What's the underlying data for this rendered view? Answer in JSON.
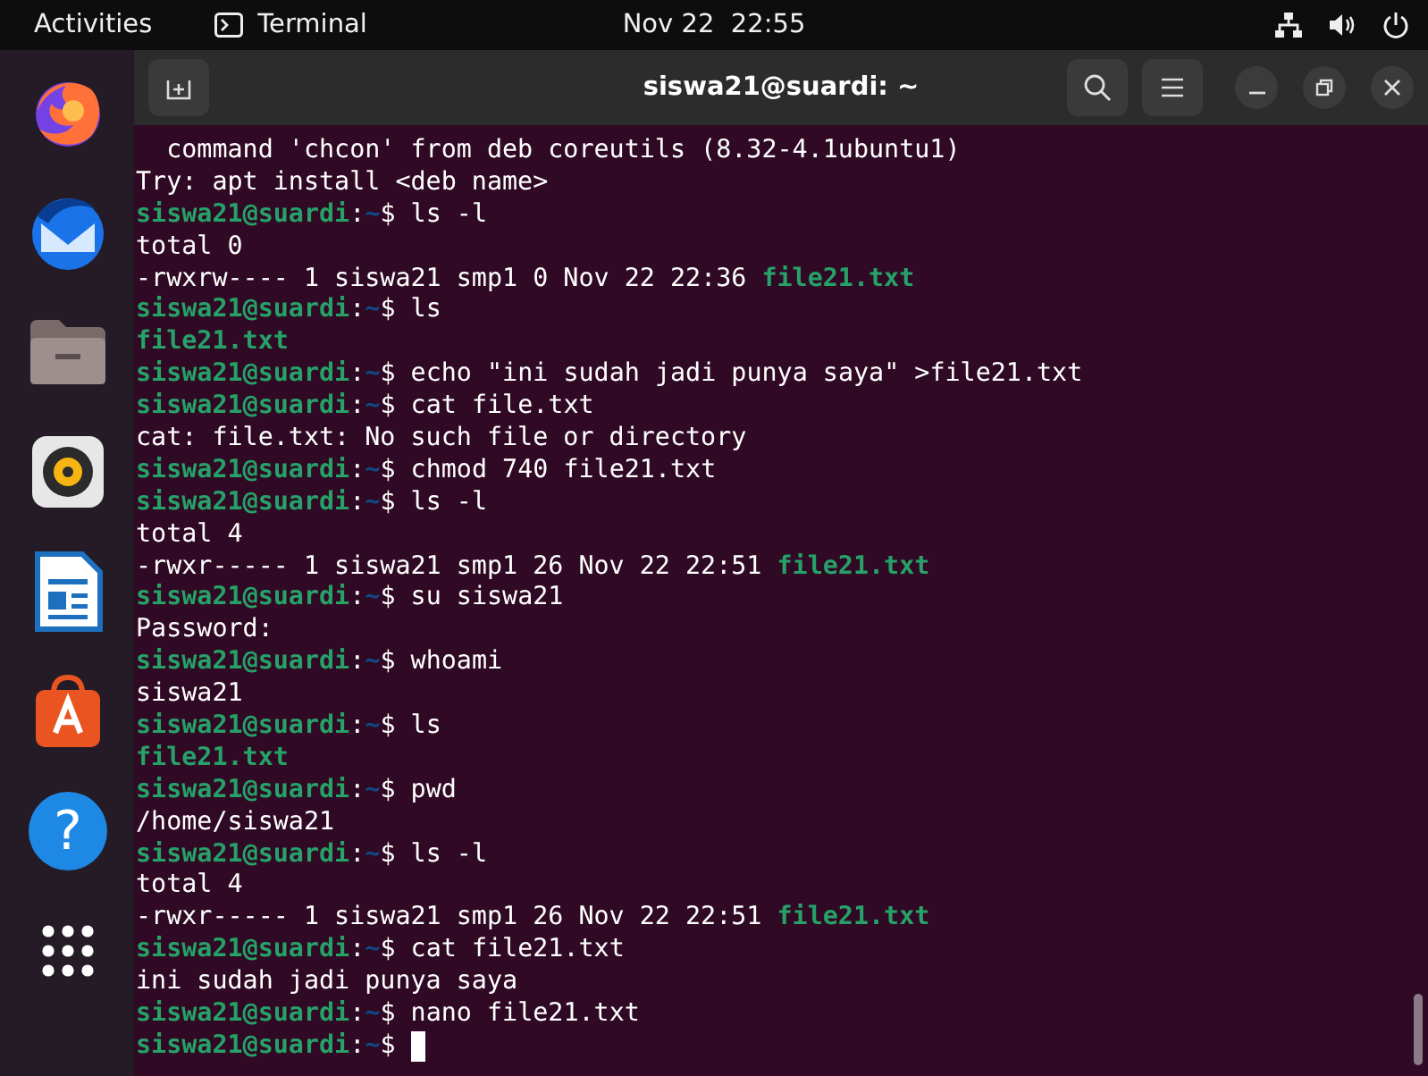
{
  "top_bar": {
    "activities": "Activities",
    "app_name": "Terminal",
    "clock": "Nov 22  22:55"
  },
  "dock": {
    "items": [
      {
        "kind": "firefox"
      },
      {
        "kind": "mail"
      },
      {
        "kind": "files"
      },
      {
        "kind": "music"
      },
      {
        "kind": "writer"
      },
      {
        "kind": "store"
      },
      {
        "kind": "help",
        "glyph": "?"
      },
      {
        "kind": "grid"
      }
    ]
  },
  "window": {
    "title": "siswa21@suardi: ~"
  },
  "terminal": {
    "cursor": true,
    "lines": [
      {
        "kind": "output",
        "text": "  command 'chcon' from deb coreutils (8.32-4.1ubuntu1)"
      },
      {
        "kind": "output",
        "text": "Try: apt install <deb name>"
      },
      {
        "kind": "prompt",
        "user": "siswa21@suardi",
        "sep": ":",
        "path": "~",
        "sign": "$",
        "command": "ls -l"
      },
      {
        "kind": "output",
        "text": "total 0"
      },
      {
        "kind": "listing",
        "text": "-rwxrw---- 1 siswa21 smp1 0 Nov 22 22:36",
        "file": "file21.txt"
      },
      {
        "kind": "prompt",
        "user": "siswa21@suardi",
        "sep": ":",
        "path": "~",
        "sign": "$",
        "command": "ls"
      },
      {
        "kind": "file",
        "file": "file21.txt"
      },
      {
        "kind": "prompt",
        "user": "siswa21@suardi",
        "sep": ":",
        "path": "~",
        "sign": "$",
        "command": "echo \"ini sudah jadi punya saya\" >file21.txt"
      },
      {
        "kind": "prompt",
        "user": "siswa21@suardi",
        "sep": ":",
        "path": "~",
        "sign": "$",
        "command": "cat file.txt"
      },
      {
        "kind": "output",
        "text": "cat: file.txt: No such file or directory"
      },
      {
        "kind": "prompt",
        "user": "siswa21@suardi",
        "sep": ":",
        "path": "~",
        "sign": "$",
        "command": "chmod 740 file21.txt"
      },
      {
        "kind": "prompt",
        "user": "siswa21@suardi",
        "sep": ":",
        "path": "~",
        "sign": "$",
        "command": "ls -l"
      },
      {
        "kind": "output",
        "text": "total 4"
      },
      {
        "kind": "listing",
        "text": "-rwxr----- 1 siswa21 smp1 26 Nov 22 22:51",
        "file": "file21.txt"
      },
      {
        "kind": "prompt",
        "user": "siswa21@suardi",
        "sep": ":",
        "path": "~",
        "sign": "$",
        "command": "su siswa21"
      },
      {
        "kind": "output",
        "text": "Password:"
      },
      {
        "kind": "prompt",
        "user": "siswa21@suardi",
        "sep": ":",
        "path": "~",
        "sign": "$",
        "command": "whoami"
      },
      {
        "kind": "output",
        "text": "siswa21"
      },
      {
        "kind": "prompt",
        "user": "siswa21@suardi",
        "sep": ":",
        "path": "~",
        "sign": "$",
        "command": "ls"
      },
      {
        "kind": "file",
        "file": "file21.txt"
      },
      {
        "kind": "prompt",
        "user": "siswa21@suardi",
        "sep": ":",
        "path": "~",
        "sign": "$",
        "command": "pwd"
      },
      {
        "kind": "output",
        "text": "/home/siswa21"
      },
      {
        "kind": "prompt",
        "user": "siswa21@suardi",
        "sep": ":",
        "path": "~",
        "sign": "$",
        "command": "ls -l"
      },
      {
        "kind": "output",
        "text": "total 4"
      },
      {
        "kind": "listing",
        "text": "-rwxr----- 1 siswa21 smp1 26 Nov 22 22:51",
        "file": "file21.txt"
      },
      {
        "kind": "prompt",
        "user": "siswa21@suardi",
        "sep": ":",
        "path": "~",
        "sign": "$",
        "command": "cat file21.txt"
      },
      {
        "kind": "output",
        "text": "ini sudah jadi punya saya"
      },
      {
        "kind": "prompt",
        "user": "siswa21@suardi",
        "sep": ":",
        "path": "~",
        "sign": "$",
        "command": "nano file21.txt"
      },
      {
        "kind": "prompt",
        "user": "siswa21@suardi",
        "sep": ":",
        "path": "~",
        "sign": "$"
      }
    ]
  }
}
